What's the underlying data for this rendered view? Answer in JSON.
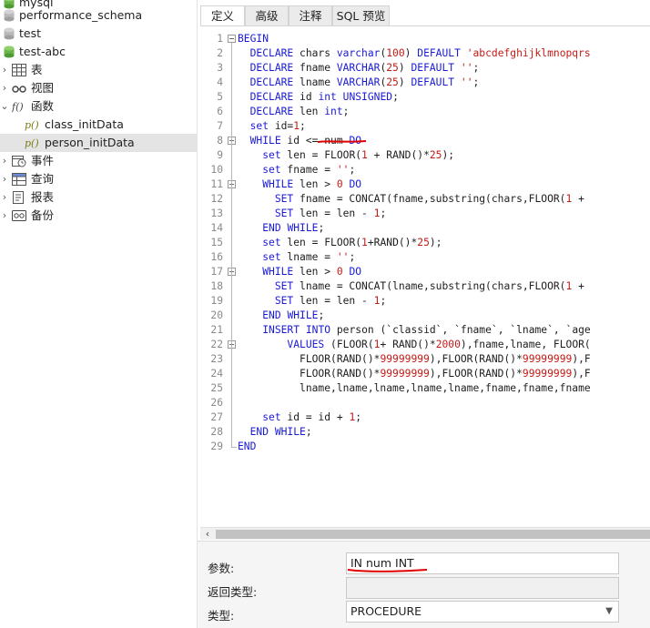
{
  "tree": {
    "items": [
      {
        "label": "mysql",
        "kind": "db"
      },
      {
        "label": "performance_schema",
        "kind": "db"
      },
      {
        "label": "test",
        "kind": "db"
      },
      {
        "label": "test-abc",
        "kind": "db-open"
      },
      {
        "label": "表",
        "kind": "table"
      },
      {
        "label": "视图",
        "kind": "view"
      },
      {
        "label": "函数",
        "kind": "function"
      },
      {
        "label": "class_initData",
        "kind": "proc"
      },
      {
        "label": "person_initData",
        "kind": "proc"
      },
      {
        "label": "事件",
        "kind": "event"
      },
      {
        "label": "查询",
        "kind": "query"
      },
      {
        "label": "报表",
        "kind": "report"
      },
      {
        "label": "备份",
        "kind": "backup"
      }
    ],
    "selected": "person_initData"
  },
  "tabs": [
    "定义",
    "高级",
    "注释",
    "SQL 预览"
  ],
  "active_tab": "定义",
  "code_lines": [
    "BEGIN",
    "  DECLARE chars varchar(100) DEFAULT 'abcdefghijklmnopqrs",
    "  DECLARE fname VARCHAR(25) DEFAULT '';",
    "  DECLARE lname VARCHAR(25) DEFAULT '';",
    "  DECLARE id int UNSIGNED;",
    "  DECLARE len int;",
    "  set id=1;",
    "  WHILE id <= num DO",
    "    set len = FLOOR(1 + RAND()*25);",
    "    set fname = '';",
    "    WHILE len > 0 DO",
    "      SET fname = CONCAT(fname,substring(chars,FLOOR(1 +",
    "      SET len = len - 1;",
    "    END WHILE;",
    "    set len = FLOOR(1+RAND()*25);",
    "    set lname = '';",
    "    WHILE len > 0 DO",
    "      SET lname = CONCAT(lname,substring(chars,FLOOR(1 +",
    "      SET len = len - 1;",
    "    END WHILE;",
    "    INSERT INTO person (`classid`, `fname`, `lname`, `age",
    "        VALUES (FLOOR(1+ RAND()*2000),fname,lname, FLOOR(",
    "          FLOOR(RAND()*99999999),FLOOR(RAND()*99999999),F",
    "          FLOOR(RAND()*99999999),FLOOR(RAND()*99999999),F",
    "          lname,lname,lname,lname,lname,fname,fname,fname",
    "",
    "    set id = id + 1;",
    "  END WHILE;",
    "END"
  ],
  "props": {
    "param_label": "参数:",
    "param_value": "IN num INT",
    "return_label": "返回类型:",
    "return_value": "",
    "type_label": "类型:",
    "type_value": "PROCEDURE"
  },
  "colors": {
    "keyword": "#1a1ad6",
    "string": "#c41a16",
    "annotation": "#e00000"
  }
}
